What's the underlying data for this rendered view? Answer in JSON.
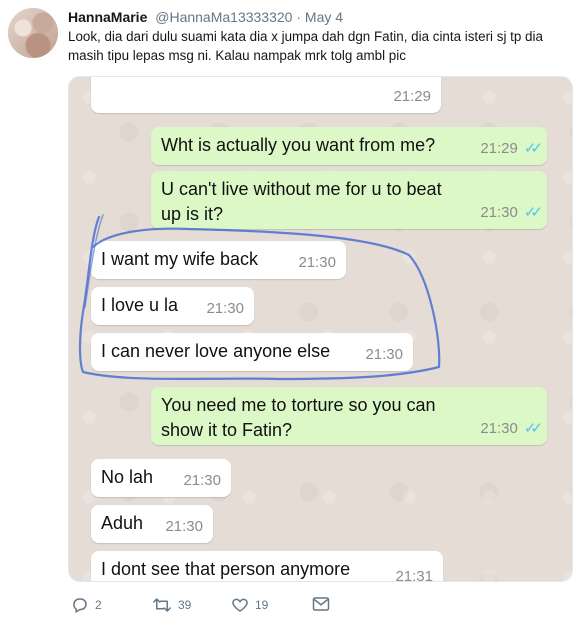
{
  "author": {
    "name": "HannaMarie",
    "handle": "@HannaMa13333320",
    "separator": "·",
    "date": "May 4"
  },
  "tweet": {
    "text": "Look, dia dari dulu suami kata dia x jumpa dah dgn Fatin, dia cinta isteri sj tp dia masih tipu lepas msg ni. Kalau nampak mrk tolg ambl pic"
  },
  "chat": {
    "messages": [
      {
        "dir": "in",
        "text": "",
        "time": "21:29"
      },
      {
        "dir": "out",
        "text": "Wht is actually you want from me?",
        "time": "21:29",
        "read": true
      },
      {
        "dir": "out",
        "text": "U can't live without me for u to beat up is it?",
        "time": "21:30",
        "read": true
      },
      {
        "dir": "in",
        "text": "I want my wife back",
        "time": "21:30"
      },
      {
        "dir": "in",
        "text": "I love u la",
        "time": "21:30"
      },
      {
        "dir": "in",
        "text": "I can never love anyone else",
        "time": "21:30"
      },
      {
        "dir": "out",
        "text": "You need me to torture so you can show it to Fatin?",
        "time": "21:30",
        "read": true
      },
      {
        "dir": "in",
        "text": "No lah",
        "time": "21:30"
      },
      {
        "dir": "in",
        "text": "Aduh",
        "time": "21:30"
      },
      {
        "dir": "in",
        "text": "I dont see that person anymore",
        "time": "21:31"
      }
    ],
    "read_receipt_icon": "double-check-icon",
    "read_color": "#4fc3f7",
    "outgoing_color": "#dcf8c6",
    "incoming_color": "#ffffff",
    "background_color": "#e5ddd5"
  },
  "actions": {
    "reply_count": "2",
    "retweet_count": "39",
    "like_count": "19",
    "icons": [
      "reply-icon",
      "retweet-icon",
      "like-icon",
      "dm-icon"
    ]
  }
}
